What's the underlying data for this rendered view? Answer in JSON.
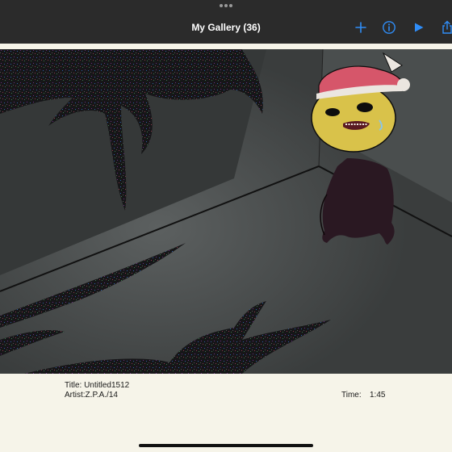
{
  "header": {
    "title": "My Gallery (36)",
    "add_icon": "plus-icon",
    "info_icon": "info-circle-icon",
    "play_icon": "play-icon",
    "share_icon": "share-icon"
  },
  "artwork": {
    "description_icon": "artwork-canvas"
  },
  "details": {
    "title_line": "Title: Untitled1512",
    "artist_line": "Artist:Z.P.A./14",
    "time_label": "Time:",
    "time_value": "1:45"
  },
  "colors": {
    "bar_bg": "#2b2b2b",
    "accent": "#2f8df7",
    "panel_bg": "#f6f4e9"
  }
}
